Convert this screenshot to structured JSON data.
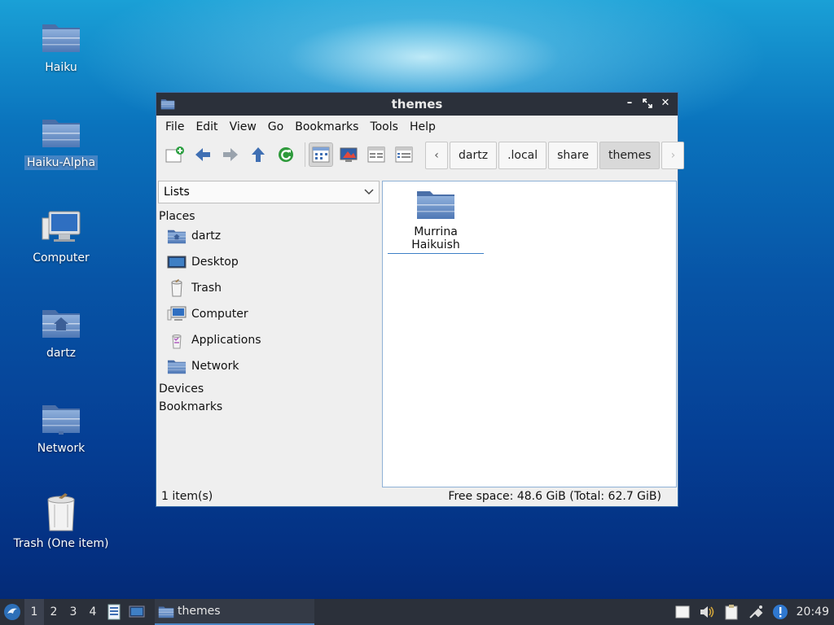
{
  "desktop": {
    "icons": [
      {
        "label": "Haiku",
        "icon": "folder-icon"
      },
      {
        "label": "Haiku-Alpha",
        "icon": "folder-icon"
      },
      {
        "label": "Computer",
        "icon": "computer-icon"
      },
      {
        "label": "dartz",
        "icon": "home-folder-icon"
      },
      {
        "label": "Network",
        "icon": "network-folder-icon"
      },
      {
        "label": "Trash (One item)",
        "icon": "trash-full-icon"
      }
    ]
  },
  "window": {
    "title": "themes",
    "menu": [
      "File",
      "Edit",
      "View",
      "Go",
      "Bookmarks",
      "Tools",
      "Help"
    ],
    "toolbar": {
      "buttons": [
        "new-folder-icon",
        "back-arrow-icon",
        "forward-arrow-icon",
        "up-arrow-icon",
        "reload-icon",
        "icon-view-icon",
        "thumbnail-view-icon",
        "compact-view-icon",
        "detailed-list-view-icon"
      ]
    },
    "breadcrumb": [
      "dartz",
      ".local",
      "share",
      "themes"
    ],
    "side_panel": {
      "mode": "Lists",
      "places_header": "Places",
      "places": [
        "dartz",
        "Desktop",
        "Trash",
        "Computer",
        "Applications",
        "Network"
      ],
      "devices_header": "Devices",
      "bookmarks_header": "Bookmarks"
    },
    "files": [
      {
        "name": "Murrina Haikuish",
        "icon": "folder-icon"
      }
    ],
    "status": {
      "items": "1 item(s)",
      "free_space": "Free space: 48.6 GiB (Total: 62.7 GiB)"
    }
  },
  "taskbar": {
    "workspaces": [
      "1",
      "2",
      "3",
      "4"
    ],
    "task_label": "themes",
    "clock": "20:49"
  },
  "colors": {
    "accent": "#3d7fc7",
    "titlebar": "#2b303a",
    "folder": "#6b8fc4"
  }
}
